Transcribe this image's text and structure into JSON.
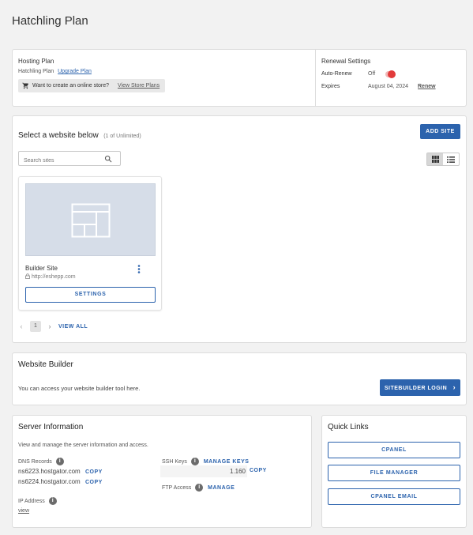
{
  "page": {
    "title": "Hatchling Plan"
  },
  "plan": {
    "hosting_heading": "Hosting Plan",
    "plan_name": "Hatchling Plan",
    "upgrade_link": "Upgrade Plan",
    "store_prompt": "Want to create an online store?",
    "store_link": "View Store Plans",
    "renewal_heading": "Renewal Settings",
    "auto_renew_label": "Auto-Renew",
    "auto_renew_value": "Off",
    "expires_label": "Expires",
    "expires_value": "August 04, 2024",
    "renew_link": "Renew"
  },
  "sites": {
    "heading": "Select a website below",
    "count_note": "(1 of Unlimited)",
    "add_button": "ADD SITE",
    "search_placeholder": "Search sites",
    "items": [
      {
        "name": "Builder Site",
        "url": "http://eshepp.com",
        "settings_label": "SETTINGS"
      }
    ],
    "pagination": {
      "current_page": "1",
      "view_all": "VIEW ALL"
    }
  },
  "builder": {
    "heading": "Website Builder",
    "description": "You can access your website builder tool here.",
    "login_button": "SITEBUILDER LOGIN"
  },
  "server": {
    "heading": "Server Information",
    "description": "View and manage the server information and access.",
    "dns_label": "DNS Records",
    "dns_records": [
      {
        "host": "ns6223.hostgator.com",
        "copy": "COPY"
      },
      {
        "host": "ns6224.hostgator.com",
        "copy": "COPY"
      }
    ],
    "ip_label": "IP Address",
    "ip_link": "view",
    "ssh_label": "SSH Keys",
    "ssh_manage": "MANAGE KEYS",
    "ssh_value": "1.160",
    "ssh_copy": "COPY",
    "ftp_label": "FTP Access",
    "ftp_manage": "MANAGE"
  },
  "quick_links": {
    "heading": "Quick Links",
    "items": [
      "CPANEL",
      "FILE MANAGER",
      "CPANEL EMAIL"
    ]
  },
  "colors": {
    "accent": "#2c63ad",
    "toggle_off": "#e23b3b",
    "page_bg": "#f2f2f2"
  },
  "icons": [
    "cart-icon",
    "search-icon",
    "grid-view-icon",
    "list-view-icon",
    "layout-placeholder-icon",
    "lock-icon",
    "kebab-menu-icon",
    "chevron-left-icon",
    "chevron-right-icon",
    "info-icon"
  ]
}
